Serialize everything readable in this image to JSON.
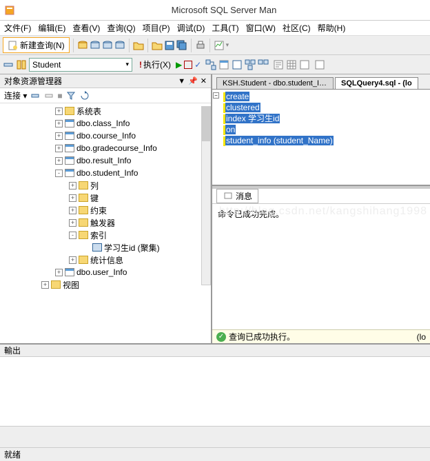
{
  "app_title": "Microsoft SQL Server Man",
  "menu": [
    "文件(F)",
    "编辑(E)",
    "查看(V)",
    "查询(Q)",
    "项目(P)",
    "调试(D)",
    "工具(T)",
    "窗口(W)",
    "社区(C)",
    "帮助(H)"
  ],
  "toolbar": {
    "new_query": "新建查询(N)"
  },
  "toolbar2": {
    "database": "Student",
    "execute": "执行(X)"
  },
  "objexp": {
    "title": "对象资源管理器",
    "connect": "连接 ▾",
    "tree": [
      {
        "indent": 80,
        "exp": "+",
        "icon": "folder",
        "label": "系统表"
      },
      {
        "indent": 80,
        "exp": "+",
        "icon": "table",
        "label": "dbo.class_Info"
      },
      {
        "indent": 80,
        "exp": "+",
        "icon": "table",
        "label": "dbo.course_Info"
      },
      {
        "indent": 80,
        "exp": "+",
        "icon": "table",
        "label": "dbo.gradecourse_Info"
      },
      {
        "indent": 80,
        "exp": "+",
        "icon": "table",
        "label": "dbo.result_Info"
      },
      {
        "indent": 80,
        "exp": "-",
        "icon": "table",
        "label": "dbo.student_Info"
      },
      {
        "indent": 100,
        "exp": "+",
        "icon": "folder",
        "label": "列"
      },
      {
        "indent": 100,
        "exp": "+",
        "icon": "folder",
        "label": "键"
      },
      {
        "indent": 100,
        "exp": "+",
        "icon": "folder",
        "label": "约束"
      },
      {
        "indent": 100,
        "exp": "+",
        "icon": "folder",
        "label": "触发器"
      },
      {
        "indent": 100,
        "exp": "-",
        "icon": "folder",
        "label": "索引"
      },
      {
        "indent": 120,
        "exp": "",
        "icon": "idx",
        "label": "学习生id (聚集)"
      },
      {
        "indent": 100,
        "exp": "+",
        "icon": "folder",
        "label": "统计信息"
      },
      {
        "indent": 80,
        "exp": "+",
        "icon": "table",
        "label": "dbo.user_Info"
      },
      {
        "indent": 60,
        "exp": "+",
        "icon": "folder",
        "label": "视图"
      }
    ]
  },
  "editor": {
    "tabs": [
      {
        "label": "KSH.Student - dbo.student_Info",
        "active": false
      },
      {
        "label": "SQLQuery4.sql - (lo",
        "active": true
      }
    ],
    "sql_lines": [
      "create",
      "clustered",
      "index 学习生id",
      "on",
      "student_info (student_Name)"
    ]
  },
  "messages": {
    "tab": "消息",
    "text": "命令已成功完成。"
  },
  "watermark": "http://blog.csdn.net/kangshihang1998",
  "status_query": {
    "text": "查询已成功执行。",
    "right": "(lo"
  },
  "output": {
    "title": "輸出"
  },
  "bottom_status": "就绪"
}
